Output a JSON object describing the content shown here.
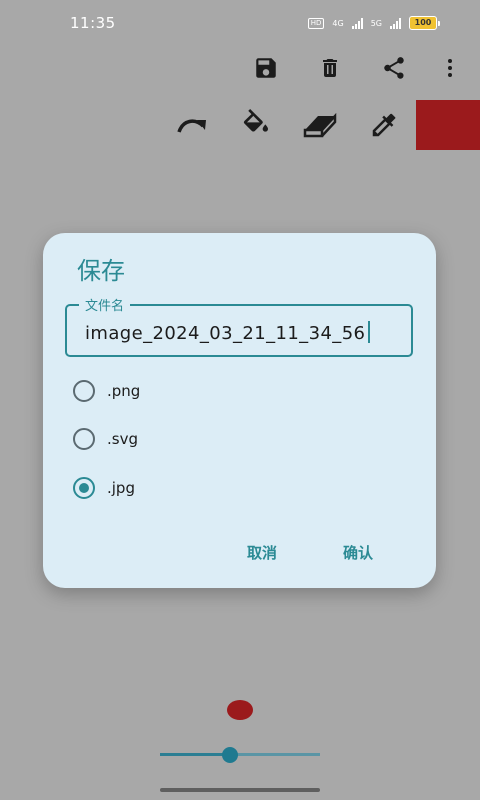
{
  "status_bar": {
    "time": "11:35",
    "hd_label": "HD",
    "net1": "4G",
    "net2": "5G",
    "battery": "100"
  },
  "toolbar": {
    "top_icons": [
      "save-icon",
      "delete-icon",
      "share-icon",
      "more-vert-icon"
    ],
    "tool_icons": [
      "redo-icon",
      "fill-bucket-icon",
      "eraser-icon",
      "eyedropper-icon"
    ],
    "current_color": "#9b1a1c"
  },
  "dialog": {
    "title": "保存",
    "file_name_label": "文件名",
    "file_name_value": "image_2024_03_21_11_34_56",
    "formats": [
      {
        "label": ".png",
        "selected": false
      },
      {
        "label": ".svg",
        "selected": false
      },
      {
        "label": ".jpg",
        "selected": true
      }
    ],
    "cancel_label": "取消",
    "confirm_label": "确认"
  },
  "brush": {
    "color": "#9b1a1c",
    "size_fraction": 0.44
  },
  "colors": {
    "accent": "#2b8a94",
    "background": "#a8a8a8",
    "dialog_bg": "#dcedf6"
  }
}
